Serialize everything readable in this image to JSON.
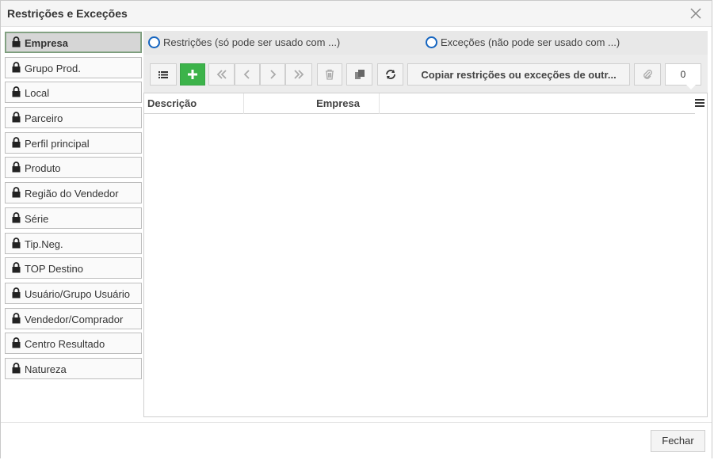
{
  "dialog": {
    "title": "Restrições e Exceções"
  },
  "sidebar": {
    "items": [
      {
        "label": "Empresa",
        "active": true
      },
      {
        "label": "Grupo Prod."
      },
      {
        "label": "Local"
      },
      {
        "label": "Parceiro"
      },
      {
        "label": "Perfil principal"
      },
      {
        "label": "Produto"
      },
      {
        "label": "Região do Vendedor"
      },
      {
        "label": "Série"
      },
      {
        "label": "Tip.Neg."
      },
      {
        "label": "TOP Destino"
      },
      {
        "label": "Usuário/Grupo Usuário"
      },
      {
        "label": "Vendedor/Comprador"
      },
      {
        "label": "Centro Resultado"
      },
      {
        "label": "Natureza"
      }
    ]
  },
  "options": {
    "restricoes_label": "Restrições (só pode ser usado com ...)",
    "excecoes_label": "Exceções (não pode ser usado com ...)"
  },
  "toolbar": {
    "copy_label": "Copiar restrições ou exceções de outr...",
    "counter": "0"
  },
  "grid": {
    "columns": [
      "Descrição",
      "Empresa"
    ]
  },
  "footer": {
    "close_label": "Fechar"
  },
  "colors": {
    "accent_blue": "#1565c0",
    "add_green": "#3cb34a"
  }
}
